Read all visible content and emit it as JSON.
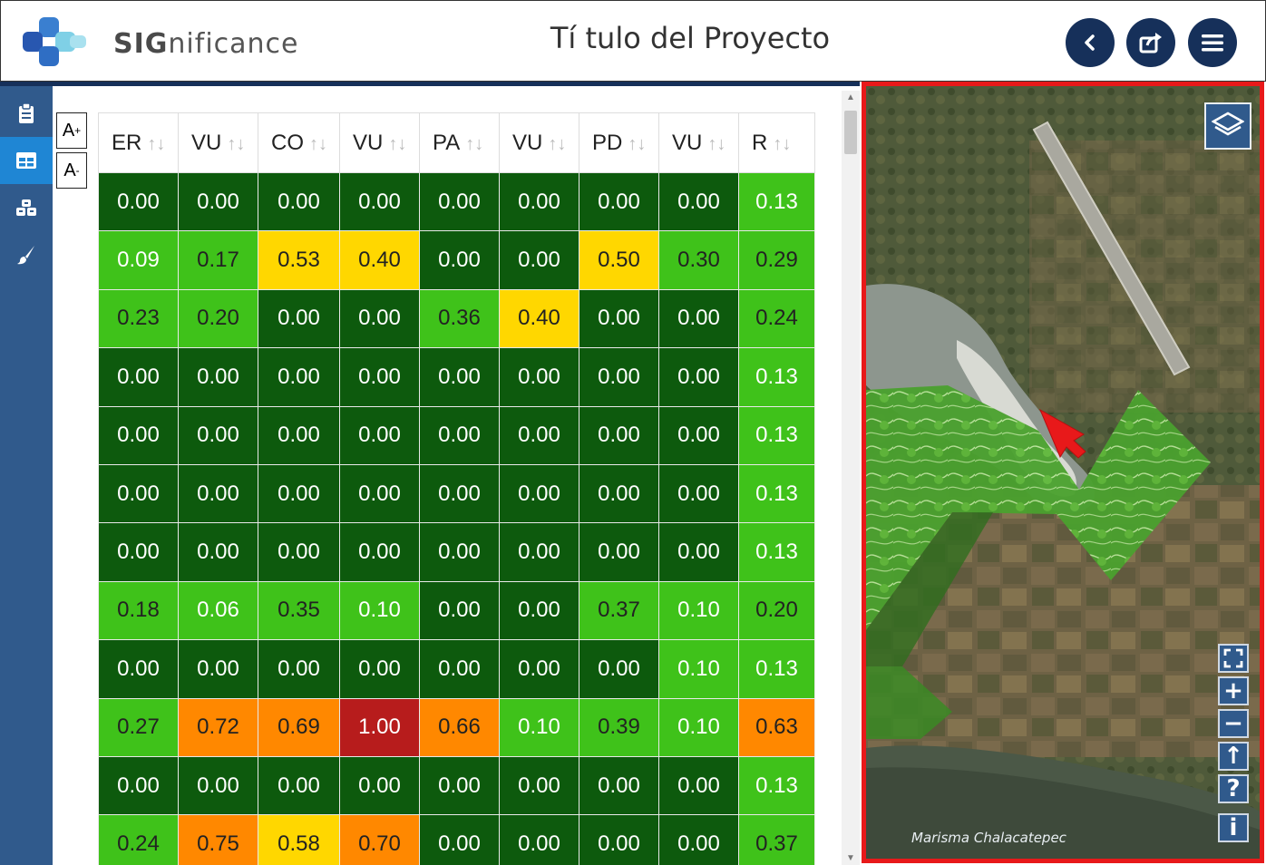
{
  "header": {
    "brand_bold": "SIG",
    "brand_rest": "nificance",
    "title": "Tí tulo del Proyecto"
  },
  "header_buttons": [
    {
      "name": "back-icon"
    },
    {
      "name": "share-icon"
    },
    {
      "name": "menu-icon"
    }
  ],
  "sidebar": {
    "items": [
      {
        "icon": "clipboard-icon",
        "active": false
      },
      {
        "icon": "table-icon",
        "active": true
      },
      {
        "icon": "cubes-icon",
        "active": false
      },
      {
        "icon": "brush-icon",
        "active": false
      }
    ]
  },
  "font_controls": {
    "increase": "A",
    "decrease": "A",
    "increase_sup": "+",
    "decrease_sup": "-"
  },
  "table": {
    "sort_glyph": "↑↓",
    "columns": [
      "ER",
      "VU",
      "CO",
      "VU",
      "PA",
      "VU",
      "PD",
      "VU",
      "R"
    ],
    "rows": [
      [
        "0.00",
        "0.00",
        "0.00",
        "0.00",
        "0.00",
        "0.00",
        "0.00",
        "0.00",
        "0.13"
      ],
      [
        "0.09",
        "0.17",
        "0.53",
        "0.40",
        "0.00",
        "0.00",
        "0.50",
        "0.30",
        "0.29"
      ],
      [
        "0.23",
        "0.20",
        "0.00",
        "0.00",
        "0.36",
        "0.40",
        "0.00",
        "0.00",
        "0.24"
      ],
      [
        "0.00",
        "0.00",
        "0.00",
        "0.00",
        "0.00",
        "0.00",
        "0.00",
        "0.00",
        "0.13"
      ],
      [
        "0.00",
        "0.00",
        "0.00",
        "0.00",
        "0.00",
        "0.00",
        "0.00",
        "0.00",
        "0.13"
      ],
      [
        "0.00",
        "0.00",
        "0.00",
        "0.00",
        "0.00",
        "0.00",
        "0.00",
        "0.00",
        "0.13"
      ],
      [
        "0.00",
        "0.00",
        "0.00",
        "0.00",
        "0.00",
        "0.00",
        "0.00",
        "0.00",
        "0.13"
      ],
      [
        "0.18",
        "0.06",
        "0.35",
        "0.10",
        "0.00",
        "0.00",
        "0.37",
        "0.10",
        "0.20"
      ],
      [
        "0.00",
        "0.00",
        "0.00",
        "0.00",
        "0.00",
        "0.00",
        "0.00",
        "0.10",
        "0.13"
      ],
      [
        "0.27",
        "0.72",
        "0.69",
        "1.00",
        "0.66",
        "0.10",
        "0.39",
        "0.10",
        "0.63"
      ],
      [
        "0.00",
        "0.00",
        "0.00",
        "0.00",
        "0.00",
        "0.00",
        "0.00",
        "0.00",
        "0.13"
      ],
      [
        "0.24",
        "0.75",
        "0.58",
        "0.70",
        "0.00",
        "0.00",
        "0.00",
        "0.00",
        "0.37"
      ]
    ],
    "color_scale": {
      "very_low": "#0d5a0d",
      "low": "#3fc21a",
      "medium": "#ffd700",
      "high": "#ff8800",
      "very_high": "#b71c1c"
    }
  },
  "map": {
    "label": "Marisma Chalacatepec",
    "controls": [
      {
        "name": "fullscreen-icon",
        "glyph": "⛶"
      },
      {
        "name": "zoom-in-icon",
        "glyph": "+"
      },
      {
        "name": "zoom-out-icon",
        "glyph": "−"
      },
      {
        "name": "north-arrow-icon",
        "glyph": "↑"
      },
      {
        "name": "help-icon",
        "glyph": "?"
      },
      {
        "name": "info-icon",
        "glyph": "i"
      }
    ]
  },
  "colors": {
    "primary": "#16305a",
    "sidebar": "#305a8c",
    "sidebar_active": "#1f86d4",
    "highlight_border": "#e8191a",
    "cursor": "#e8191a"
  }
}
